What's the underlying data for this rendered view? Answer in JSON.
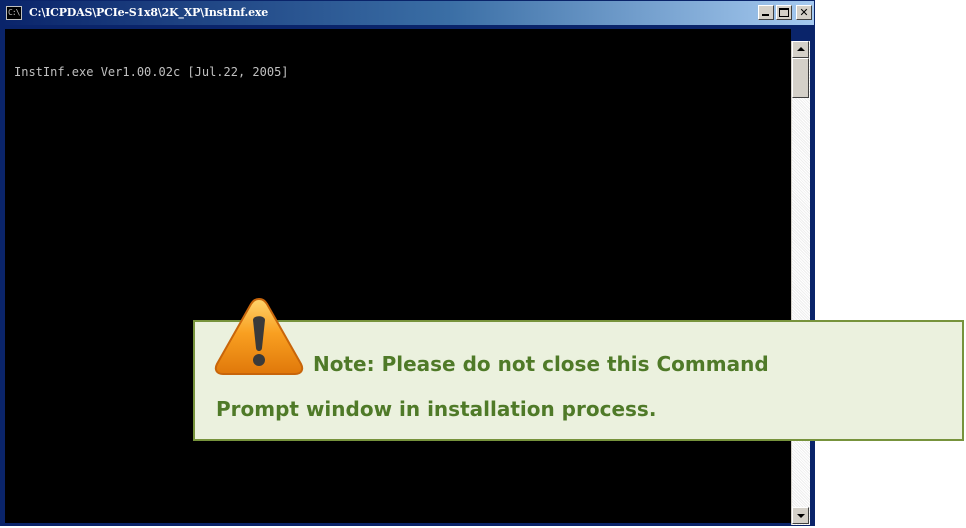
{
  "window": {
    "title": "C:\\ICPDAS\\PCIe-S1x8\\2K_XP\\InstInf.exe",
    "app_icon_text": "C:\\",
    "title_gradient": [
      "#0a246a",
      "#3a6ea5",
      "#a6caf0"
    ]
  },
  "caption_buttons": {
    "minimize_icon": "minimize-icon",
    "maximize_icon": "maximize-icon",
    "close_label": "✕"
  },
  "console": {
    "lines": [
      "InstInf.exe Ver1.00.02c [Jul.22, 2005]"
    ],
    "background": "#000000",
    "foreground": "#c0c0c0"
  },
  "scrollbar": {
    "up_icon": "scroll-up-arrow-icon",
    "down_icon": "scroll-down-arrow-icon"
  },
  "note": {
    "icon": "warning-icon",
    "line1": "Note: Please do not close this Command",
    "line2": "Prompt window in installation process.",
    "text_color": "#4f7a28",
    "background": "#ebf1de",
    "border": "#77933c"
  }
}
